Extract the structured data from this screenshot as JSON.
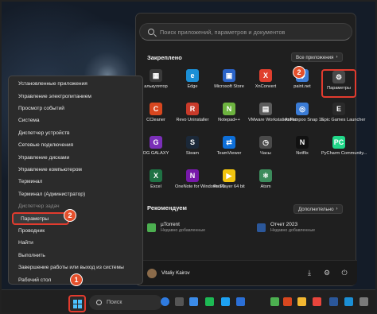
{
  "start_menu": {
    "search_placeholder": "Поиск приложений, параметров и документов",
    "pinned_title": "Закреплено",
    "all_apps_label": "Все приложения",
    "pinned_apps": [
      {
        "label": "алькулятор",
        "icon": "calculator-icon",
        "color": "#3a3a3a",
        "glyph": "▦"
      },
      {
        "label": "Edge",
        "icon": "edge-icon",
        "color": "#1b8fd6",
        "glyph": "e"
      },
      {
        "label": "Microsoft Store",
        "icon": "store-icon",
        "color": "#2b64c8",
        "glyph": "▣"
      },
      {
        "label": "XnConvert",
        "icon": "xnconvert-icon",
        "color": "#e03f2e",
        "glyph": "X"
      },
      {
        "label": "paint.net",
        "icon": "paintnet-icon",
        "color": "#3e7dd6",
        "glyph": "◆"
      },
      {
        "label": "Параметры",
        "icon": "settings-gear-icon",
        "color": "#4a4a4a",
        "glyph": "⚙"
      },
      {
        "label": "CCleaner",
        "icon": "ccleaner-icon",
        "color": "#d8471f",
        "glyph": "C"
      },
      {
        "label": "Revo Uninstaller",
        "icon": "revo-uninstaller-icon",
        "color": "#c93a2a",
        "glyph": "R"
      },
      {
        "label": "Notepad++",
        "icon": "notepadpp-icon",
        "color": "#6db33f",
        "glyph": "N"
      },
      {
        "label": "VMware Workstation Pro",
        "icon": "vmware-icon",
        "color": "#5c5c5c",
        "glyph": "▤"
      },
      {
        "label": "Ashampoo Snap 15",
        "icon": "ashampoo-snap-icon",
        "color": "#3a7bd5",
        "glyph": "◎"
      },
      {
        "label": "Epic Games Launcher",
        "icon": "epic-games-icon",
        "color": "#2a2a2a",
        "glyph": "E"
      },
      {
        "label": "OG GALAXY",
        "icon": "gog-galaxy-icon",
        "color": "#7a2fb8",
        "glyph": "G"
      },
      {
        "label": "Steam",
        "icon": "steam-icon",
        "color": "#1b2838",
        "glyph": "S"
      },
      {
        "label": "TeamViewer",
        "icon": "teamviewer-icon",
        "color": "#0e6fd8",
        "glyph": "⇄"
      },
      {
        "label": "Часы",
        "icon": "clock-icon",
        "color": "#4a4a4a",
        "glyph": "◷"
      },
      {
        "label": "Netflix",
        "icon": "netflix-icon",
        "color": "#111111",
        "glyph": "N"
      },
      {
        "label": "PyCharm Community...",
        "icon": "pycharm-icon",
        "color": "#21d789",
        "glyph": "PC"
      },
      {
        "label": "Excel",
        "icon": "excel-icon",
        "color": "#1f7244",
        "glyph": "X"
      },
      {
        "label": "OneNote for Windows 10",
        "icon": "onenote-icon",
        "color": "#7719aa",
        "glyph": "N"
      },
      {
        "label": "PotPlayer 64 bit",
        "icon": "potplayer-icon",
        "color": "#f1c40f",
        "glyph": "▶"
      },
      {
        "label": "Atom",
        "icon": "atom-icon",
        "color": "#3c8c5c",
        "glyph": "⚛"
      }
    ],
    "recommended_title": "Рекомендуем",
    "more_label": "Дополнительно",
    "recommended": [
      {
        "name": "µTorrent",
        "sub": "Недавно добавленные",
        "icon": "utorrent-icon",
        "color": "#4caf50"
      },
      {
        "name": "Отчет 2023",
        "sub": "Недавно добавленные",
        "icon": "word-document-icon",
        "color": "#2b579a"
      }
    ],
    "user_name": "Vitaliy Kairov"
  },
  "context_menu": {
    "items": [
      "Установленные приложения",
      "Управление электропитанием",
      "Просмотр событий",
      "Система",
      "Диспетчер устройств",
      "Сетевые подключения",
      "Управление дисками",
      "Управление компьютером",
      "Терминал",
      "Терминал (Администратор)",
      "Диспетчер задач",
      "Параметры",
      "Проводник",
      "Найти",
      "Выполнить",
      "Завершение работы или выход из системы",
      "Рабочий стол"
    ]
  },
  "taskbar": {
    "search_label": "Поиск",
    "icons": [
      {
        "name": "copilot-icon",
        "color": "#2f7be0"
      },
      {
        "name": "task-view-icon",
        "color": "#555555"
      },
      {
        "name": "widgets-icon",
        "color": "#3b8be8"
      },
      {
        "name": "spotify-icon",
        "color": "#1db954"
      },
      {
        "name": "twitter-icon",
        "color": "#1da1f2"
      },
      {
        "name": "tasks-icon",
        "color": "#2b6fd6"
      },
      {
        "name": "notepad-icon",
        "color": "#4caf50"
      },
      {
        "name": "ccleaner-icon",
        "color": "#d8471f"
      },
      {
        "name": "file-explorer-icon",
        "color": "#f2b731"
      },
      {
        "name": "chrome-icon",
        "color": "#e8453c"
      },
      {
        "name": "word-icon",
        "color": "#2b579a"
      },
      {
        "name": "edge-icon",
        "color": "#1b8fd6"
      },
      {
        "name": "photos-icon",
        "color": "#7a7a7a"
      }
    ]
  },
  "callouts": [
    "1",
    "2",
    "2"
  ]
}
